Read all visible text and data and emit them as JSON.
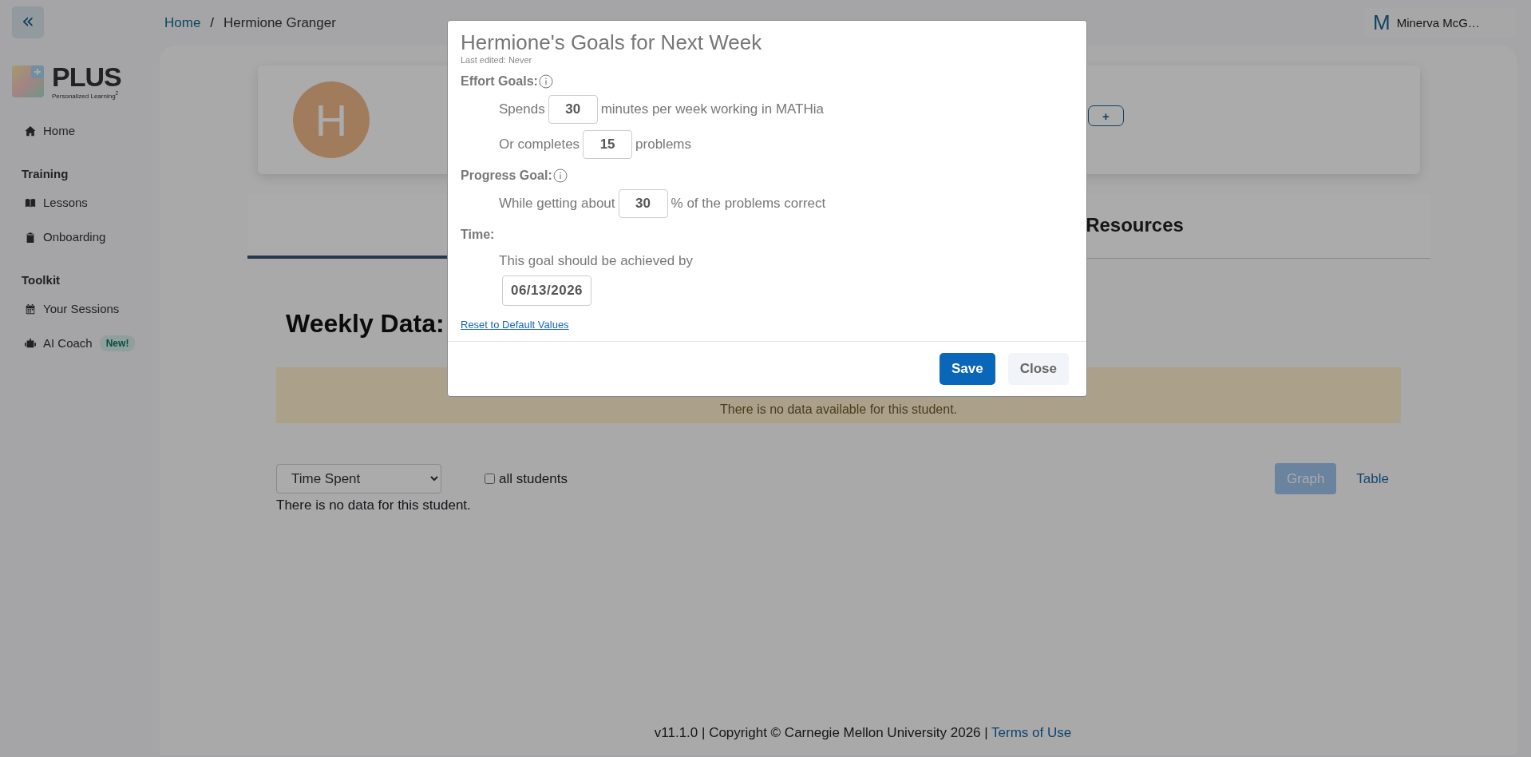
{
  "sidebar": {
    "collapse_label": "«",
    "logo": {
      "name": "PLUS",
      "tagline": "Personalized Learning$^{2}$"
    },
    "sections": [
      {
        "items": [
          {
            "label": "Home"
          }
        ]
      },
      {
        "heading": "Training",
        "items": [
          {
            "label": "Lessons"
          },
          {
            "label": "Onboarding"
          }
        ]
      },
      {
        "heading": "Toolkit",
        "items": [
          {
            "label": "Your Sessions"
          },
          {
            "label": "AI Coach",
            "badge": "New!"
          }
        ]
      }
    ]
  },
  "breadcrumb": [
    {
      "label": "Home",
      "kind": "link"
    },
    {
      "label": "Hermione Granger",
      "kind": "current"
    }
  ],
  "breadcrumb_separator": "/",
  "user": {
    "initial": "M",
    "name": "Minerva McG…"
  },
  "profile": {
    "initial": "H",
    "add_label": "+"
  },
  "tabs": [
    {
      "selected": true
    },
    {
      "label": "Resources",
      "selected": false
    }
  ],
  "weekly": {
    "heading": "Weekly Data:",
    "alert": "There is no data available for this student.",
    "metric": "Time Spent",
    "all_students": {
      "label": "all students",
      "checked": false
    },
    "views": [
      {
        "label": "Graph",
        "selected": true
      },
      {
        "label": "Table",
        "selected": false
      }
    ],
    "empty": "There is no data for this student."
  },
  "footer": {
    "text": "v11.1.0 | Copyright © Carnegie Mellon University 2026 | ",
    "link": "Terms of Use"
  },
  "modal": {
    "title": "Hermione's Goals for Next Week",
    "subtitle": "Last edited: Never",
    "sections": [
      {
        "heading": "Effort Goals:",
        "info": true,
        "rows": [
          {
            "kind": "input",
            "before": "Spends",
            "value": "30",
            "after": "minutes per week working in MATHia"
          },
          {
            "kind": "input",
            "before": "Or completes",
            "value": "15",
            "after": "problems"
          }
        ]
      },
      {
        "heading": "Progress Goal:",
        "info": true,
        "rows": [
          {
            "kind": "input",
            "before": "While getting about",
            "value": "30",
            "after": "% of the problems correct"
          }
        ]
      },
      {
        "heading": "Time:",
        "info": false,
        "rows": [
          {
            "kind": "text",
            "text": "This goal should be achieved by"
          },
          {
            "kind": "date",
            "value": "06/13/2026"
          }
        ]
      }
    ],
    "reset": "Reset to Default Values",
    "buttons": [
      {
        "label": "Save",
        "kind": "primary"
      },
      {
        "label": "Close",
        "kind": "secondary"
      }
    ]
  }
}
